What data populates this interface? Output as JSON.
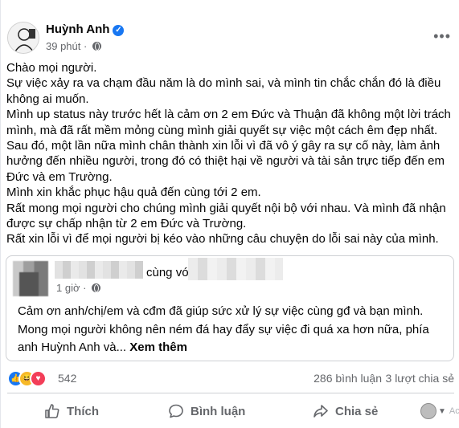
{
  "post": {
    "author": "Huỳnh Anh",
    "time": "39 phút",
    "paragraphs": [
      "Chào mọi người.",
      "Sự việc xảy ra va chạm đầu năm là do mình sai, và mình tin chắc chắn đó là điều không ai muốn.",
      "Mình up status này trước hết là cảm ơn 2 em Đức và Thuận đã không một lời trách mình, mà đã rất mềm mỏng cùng mình giải quyết sự việc một cách êm đẹp nhất.",
      "Sau đó, một lần nữa mình chân thành xin lỗi vì đã vô ý gây ra sự cố này, làm ảnh hưởng đến nhiều người, trong đó có thiệt hại về người và tài sản trực tiếp đến em Đức và em Trường.",
      "Mình xin khắc phục hậu quả đến cùng tới 2 em.",
      "Rất mong mọi người cho chúng mình giải quyết nội bộ với nhau. Và mình đã nhận được sự chấp nhận từ 2 em Đức và Trường.",
      "Rất xin lỗi vì để mọi người bị kéo vào những câu chuyện do lỗi sai này của mình."
    ]
  },
  "shared": {
    "with_text": "cùng với",
    "time": "1 giờ",
    "text": "Cảm ơn anh/chị/em và cđm đã giúp sức xử lý sự việc cùng gđ và bạn mình. Mong mọi người không nên ném đá hay đẩy sự việc đi quá xa hơn nữa, phía anh Huỳnh Anh và...",
    "see_more": "Xem thêm"
  },
  "stats": {
    "reactions": "542",
    "comments": "286 bình luận",
    "shares": "3 lượt chia sẻ"
  },
  "actions": {
    "like": "Thích",
    "comment": "Bình luận",
    "share": "Chia sẻ",
    "faded": "Act"
  },
  "colors": {
    "facebook_blue": "#1877f2",
    "text": "#050505",
    "secondary_text": "#65676b",
    "divider": "#ced0d4"
  },
  "icons": [
    "verified-badge-icon",
    "globe-icon",
    "more-icon",
    "like-reaction-icon",
    "haha-reaction-icon",
    "love-reaction-icon",
    "thumbs-up-icon",
    "comment-icon",
    "share-icon"
  ]
}
